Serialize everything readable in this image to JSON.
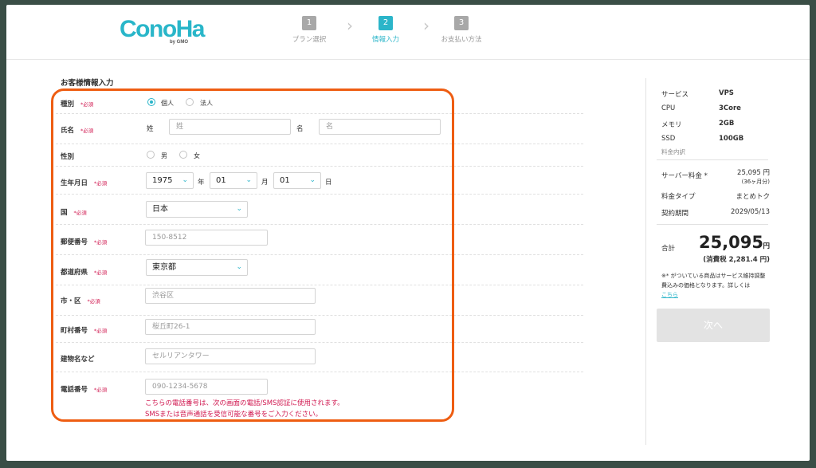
{
  "header": {
    "logo": "ConoHa",
    "logo_sub": "by GMO",
    "steps": [
      {
        "num": "1",
        "label": "プラン選択"
      },
      {
        "num": "2",
        "label": "情報入力"
      },
      {
        "num": "3",
        "label": "お支払い方法"
      }
    ],
    "active_step": 2
  },
  "form": {
    "section_title": "お客様情報入力",
    "required": "*必須",
    "type": {
      "label": "種別",
      "options": [
        "個人",
        "法人"
      ],
      "selected": "個人"
    },
    "name": {
      "label": "氏名",
      "last_label": "姓",
      "last_placeholder": "姓",
      "first_label": "名",
      "first_placeholder": "名"
    },
    "gender": {
      "label": "性別",
      "options": [
        "男",
        "女"
      ]
    },
    "birth": {
      "label": "生年月日",
      "year": "1975",
      "year_unit": "年",
      "month": "01",
      "month_unit": "月",
      "day": "01",
      "day_unit": "日"
    },
    "country": {
      "label": "国",
      "value": "日本"
    },
    "postal": {
      "label": "郵便番号",
      "placeholder": "150-8512"
    },
    "prefecture": {
      "label": "都道府県",
      "value": "東京都"
    },
    "city": {
      "label": "市・区",
      "placeholder": "渋谷区"
    },
    "street": {
      "label": "町村番号",
      "placeholder": "桜丘町26-1"
    },
    "building": {
      "label": "建物名など",
      "placeholder": "セルリアンタワー"
    },
    "phone": {
      "label": "電話番号",
      "placeholder": "090-1234-5678",
      "note_1": "こちらの電話番号は、次の画面の電話/SMS認証に使用されます。",
      "note_2": "SMSまたは音声通話を受信可能な番号をご入力ください。"
    }
  },
  "summary": {
    "service_label": "サービス",
    "service_value": "VPS",
    "cpu_label": "CPU",
    "cpu_value": "3Core",
    "memory_label": "メモリ",
    "memory_value": "2GB",
    "ssd_label": "SSD",
    "ssd_value": "100GB",
    "breakdown_label": "料金内訳",
    "server_fee_label": "サーバー料金 *",
    "server_fee_value": "25,095 円",
    "server_fee_sub": "(36ヶ月分)",
    "fee_type_label": "料金タイプ",
    "fee_type_value": "まとめトク",
    "period_label": "契約期間",
    "period_value": "2029/05/13",
    "total_label": "合計",
    "total_value": "25,095",
    "total_unit": "円",
    "tax_text": "(消費税 2,281.4 円)",
    "footnote": "※* がついている商品はサービス維持調整費込みの価格となります。詳しくは",
    "footnote_link": "こちら",
    "next_button": "次へ"
  }
}
